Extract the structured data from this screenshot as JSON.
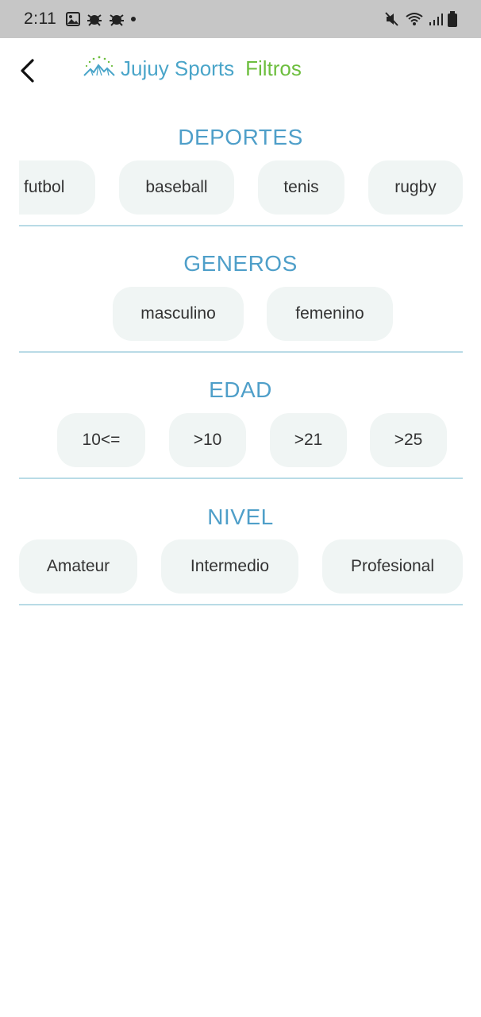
{
  "status_bar": {
    "time": "2:11",
    "left_icons": [
      "image-icon",
      "bug-icon",
      "bug-icon",
      "dot-icon"
    ],
    "right_icons": [
      "mute-icon",
      "wifi-icon",
      "signal-icon",
      "battery-icon"
    ]
  },
  "header": {
    "back_icon": "chevron-left-icon",
    "brand": "Jujuy Sports",
    "subtitle": "Filtros",
    "brand_color": "#4aa5c9",
    "subtitle_color": "#6dbe3e"
  },
  "sections": [
    {
      "title": "DEPORTES",
      "options": [
        "futbol",
        "baseball",
        "tenis",
        "rugby"
      ]
    },
    {
      "title": "GENEROS",
      "options": [
        "masculino",
        "femenino"
      ]
    },
    {
      "title": "EDAD",
      "options": [
        "10<=",
        ">10",
        ">21",
        ">25"
      ]
    },
    {
      "title": "NIVEL",
      "options": [
        "Amateur",
        "Intermedio",
        "Profesional"
      ]
    }
  ],
  "colors": {
    "section_title": "#4f9fc9",
    "chip_background": "#f0f5f4",
    "divider": "#b9dbe6"
  }
}
